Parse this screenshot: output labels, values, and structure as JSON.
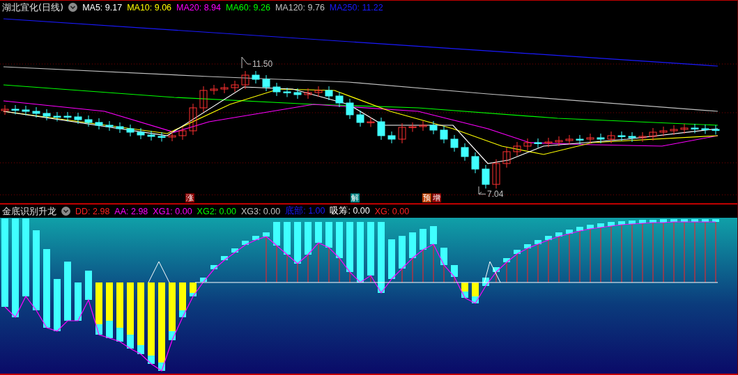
{
  "price_panel": {
    "title": "湖北宜化(日线)",
    "legend": [
      {
        "label": "MA5: 9.17",
        "color": "#ffffff"
      },
      {
        "label": "MA10: 9.06",
        "color": "#ffff00"
      },
      {
        "label": "MA20: 8.94",
        "color": "#ff00ff"
      },
      {
        "label": "MA60: 9.26",
        "color": "#00ff00"
      },
      {
        "label": "MA120: 9.76",
        "color": "#c0c0c0"
      },
      {
        "label": "MA250: 11.22",
        "color": "#1a1aff"
      }
    ],
    "high_label": "11.50",
    "low_label": "7.04",
    "signals": [
      {
        "text": "涨",
        "color": "#8b0000"
      },
      {
        "text": "解",
        "color": "#008080"
      },
      {
        "text": "预",
        "color": "#c04000"
      },
      {
        "text": "增",
        "color": "#8b0000"
      }
    ]
  },
  "indicator_panel": {
    "title": "金底识别升龙",
    "legend": [
      {
        "label": "DD: 2.98",
        "color": "#ff2020"
      },
      {
        "label": "AA: 2.98",
        "color": "#ff00ff"
      },
      {
        "label": "XG1: 0.00",
        "color": "#ff00ff"
      },
      {
        "label": "XG2: 0.00",
        "color": "#00ff00"
      },
      {
        "label": "XG3: 0.00",
        "color": "#c0c0c0"
      },
      {
        "label": "底部: 1.00",
        "color": "#1a1aff"
      },
      {
        "label": "吸筹: 0.00",
        "color": "#ffffff"
      },
      {
        "label": "XG: 0.00",
        "color": "#ff2020"
      }
    ]
  }
}
